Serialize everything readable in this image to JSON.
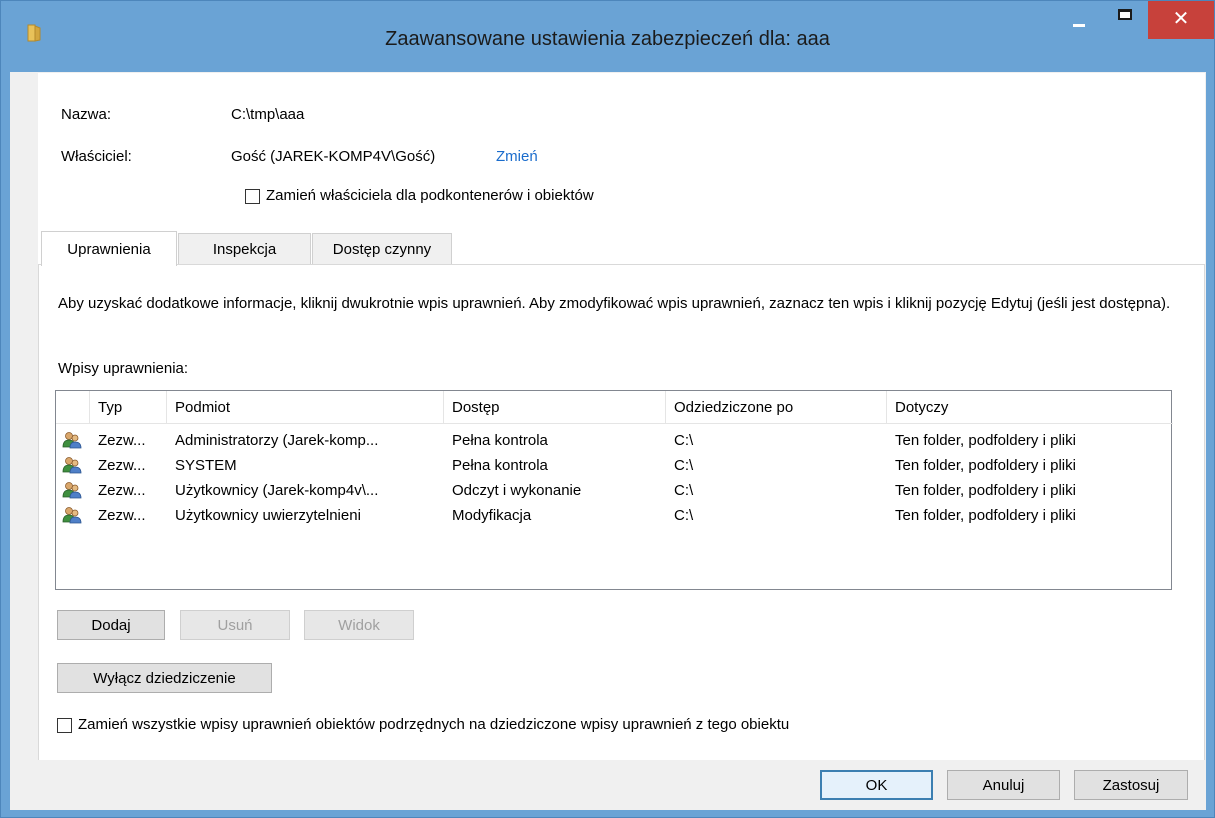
{
  "window": {
    "title": "Zaawansowane ustawienia zabezpieczeń dla: aaa",
    "close_glyph": "✕"
  },
  "info": {
    "name_label": "Nazwa:",
    "name_value": "C:\\tmp\\aaa",
    "owner_label": "Właściciel:",
    "owner_value": "Gość (JAREK-KOMP4V\\Gość)",
    "owner_change_link": "Zmień",
    "replace_owner_checkbox_label": "Zamień właściciela dla podkontenerów i obiektów",
    "replace_owner_checked": false
  },
  "tabs": [
    {
      "label": "Uprawnienia",
      "active": true
    },
    {
      "label": "Inspekcja",
      "active": false
    },
    {
      "label": "Dostęp czynny",
      "active": false
    }
  ],
  "permissions": {
    "description": "Aby uzyskać dodatkowe informacje, kliknij dwukrotnie wpis uprawnień. Aby zmodyfikować wpis uprawnień, zaznacz ten wpis i kliknij pozycję Edytuj (jeśli jest dostępna).",
    "entries_label": "Wpisy uprawnienia:",
    "columns": [
      "Typ",
      "Podmiot",
      "Dostęp",
      "Odziedziczone po",
      "Dotyczy"
    ],
    "rows": [
      {
        "icon": "users-icon",
        "type": "Zezw...",
        "principal": "Administratorzy (Jarek-komp...",
        "access": "Pełna kontrola",
        "inherited": "C:\\",
        "applies": "Ten folder, podfoldery i pliki"
      },
      {
        "icon": "users-icon",
        "type": "Zezw...",
        "principal": "SYSTEM",
        "access": "Pełna kontrola",
        "inherited": "C:\\",
        "applies": "Ten folder, podfoldery i pliki"
      },
      {
        "icon": "users-icon",
        "type": "Zezw...",
        "principal": "Użytkownicy (Jarek-komp4v\\...",
        "access": "Odczyt i wykonanie",
        "inherited": "C:\\",
        "applies": "Ten folder, podfoldery i pliki"
      },
      {
        "icon": "users-icon",
        "type": "Zezw...",
        "principal": "Użytkownicy uwierzytelnieni",
        "access": "Modyfikacja",
        "inherited": "C:\\",
        "applies": "Ten folder, podfoldery i pliki"
      }
    ],
    "add_button": "Dodaj",
    "remove_button": "Usuń",
    "view_button": "Widok",
    "disable_inheritance_button": "Wyłącz dziedziczenie",
    "replace_all_checkbox_label": "Zamień wszystkie wpisy uprawnień obiektów podrzędnych na dziedziczone wpisy uprawnień z tego obiektu",
    "replace_all_checked": false
  },
  "footer": {
    "ok": "OK",
    "cancel": "Anuluj",
    "apply": "Zastosuj"
  },
  "colors": {
    "title_bar": "#6aa3d5",
    "close_button": "#c7413b",
    "link": "#1a6ccc"
  }
}
